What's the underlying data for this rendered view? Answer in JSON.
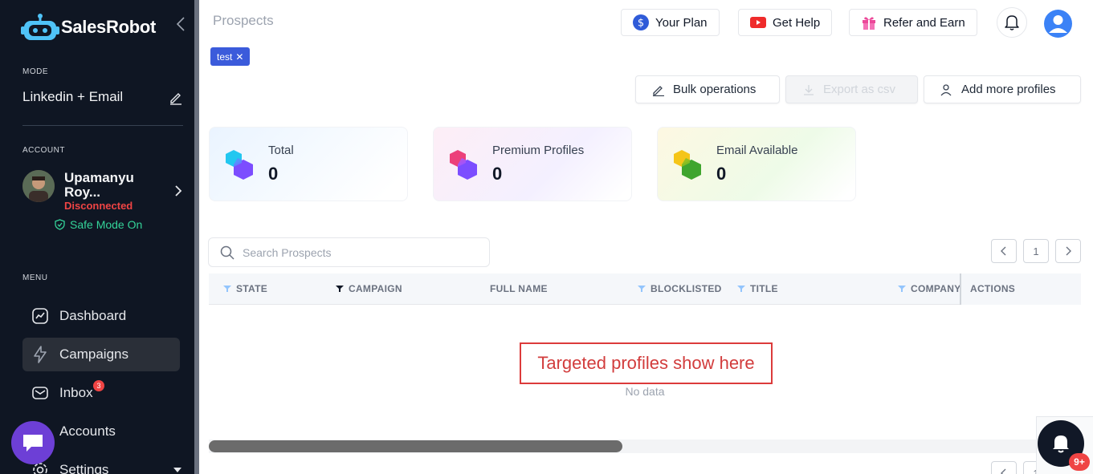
{
  "brand": {
    "name": "SalesRobot"
  },
  "sidebar": {
    "mode_label": "MODE",
    "mode_value": "Linkedin + Email",
    "account_label": "ACCOUNT",
    "account_name": "Upamanyu Roy...",
    "account_status": "Disconnected",
    "safe_mode": "Safe Mode On",
    "menu_label": "MENU",
    "items": [
      {
        "label": "Dashboard",
        "icon": "dashboard-icon"
      },
      {
        "label": "Campaigns",
        "icon": "lightning-icon",
        "active": true
      },
      {
        "label": "Inbox",
        "icon": "mail-icon",
        "badge": "3"
      },
      {
        "label": "Accounts",
        "icon": "accounts-icon"
      },
      {
        "label": "Settings",
        "icon": "gear-icon"
      }
    ]
  },
  "header": {
    "title": "Prospects",
    "buttons": {
      "plan": "Your Plan",
      "help": "Get Help",
      "refer": "Refer and Earn"
    }
  },
  "filter_tag": "test",
  "actions": {
    "bulk": "Bulk operations",
    "export": "Export as csv",
    "add": "Add more profiles"
  },
  "stats": [
    {
      "label": "Total",
      "value": "0"
    },
    {
      "label": "Premium Profiles",
      "value": "0"
    },
    {
      "label": "Email Available",
      "value": "0"
    }
  ],
  "search": {
    "placeholder": "Search Prospects"
  },
  "pagination": {
    "current": "1"
  },
  "table": {
    "columns": [
      "STATE",
      "CAMPAIGN",
      "FULL NAME",
      "BLOCKLISTED",
      "TITLE",
      "COMPANY",
      "ACTIONS"
    ],
    "empty_text": "No data"
  },
  "annotation": "Targeted profiles show here",
  "notifications": {
    "badge": "9+"
  },
  "colors": {
    "sidebar_bg": "#0f1623",
    "accent_blue": "#3b5bdb",
    "danger": "#ef4444",
    "success": "#34d399",
    "annotation": "#dc3b3b"
  }
}
